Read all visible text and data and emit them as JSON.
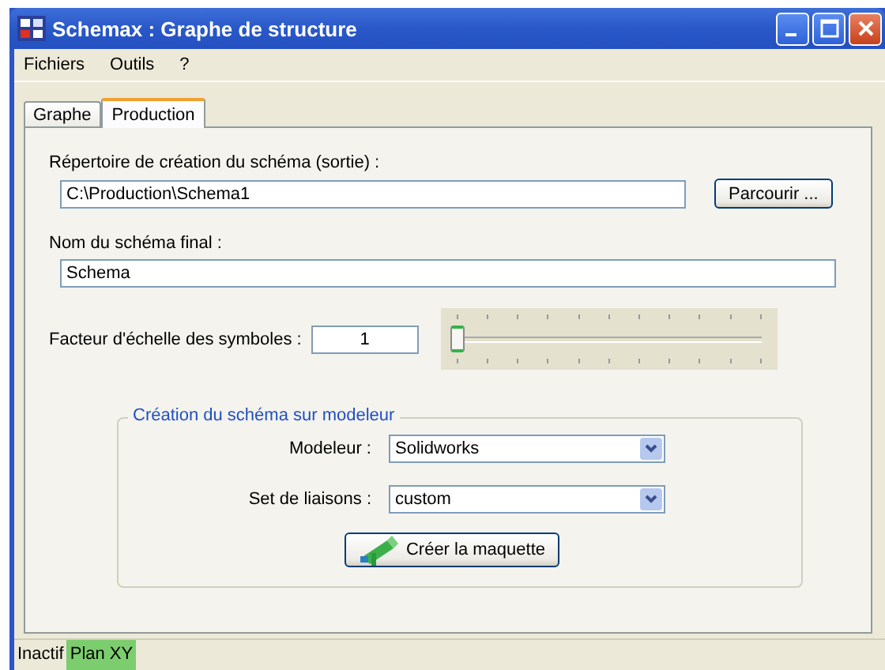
{
  "window": {
    "title": "Schemax : Graphe de structure"
  },
  "menu": [
    "Fichiers",
    "Outils",
    "?"
  ],
  "tabs": [
    {
      "label": "Graphe",
      "selected": false
    },
    {
      "label": "Production",
      "selected": true
    }
  ],
  "output_dir": {
    "label": "Répertoire de création du schéma (sortie) :",
    "value": "C:\\Production\\Schema1",
    "button": "Parcourir ..."
  },
  "final_name": {
    "label": "Nom du schéma final :",
    "value": "Schema"
  },
  "scale": {
    "label": "Facteur d'échelle des symboles :",
    "value": "1",
    "level": 0
  },
  "modeler_group": {
    "title": "Création du schéma sur modeleur",
    "fields": [
      {
        "label": "Modeleur :",
        "value": "Solidworks"
      },
      {
        "label": "Set de liaisons :",
        "value": "custom"
      }
    ],
    "button": "Créer la maquette"
  },
  "status_bar": [
    {
      "text": "Inactif",
      "highlighted": false
    },
    {
      "text": "Plan XY",
      "highlighted": true
    }
  ]
}
